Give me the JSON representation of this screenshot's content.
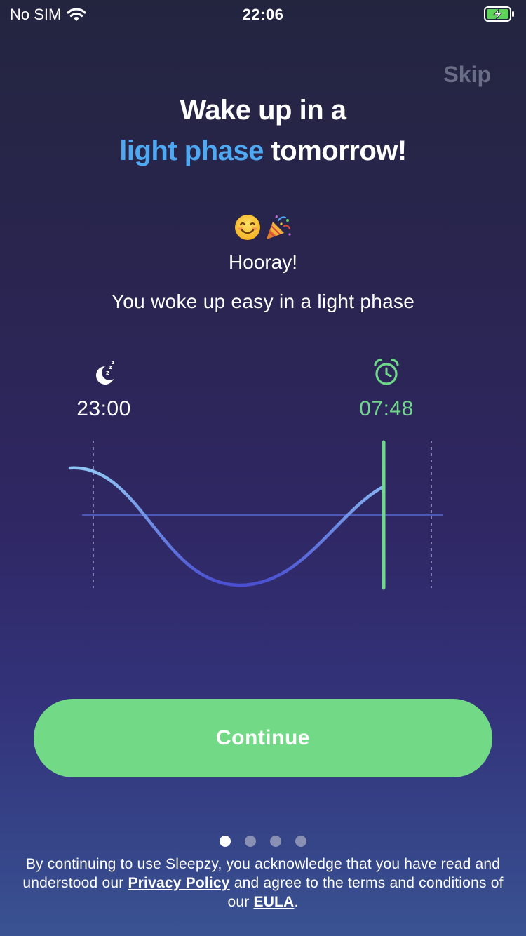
{
  "status_bar": {
    "carrier": "No SIM",
    "time": "22:06",
    "icons": [
      "wifi-icon",
      "battery-charging-icon"
    ]
  },
  "header": {
    "skip_label": "Skip",
    "title_line1": "Wake up in a",
    "title_accent": "light phase",
    "title_rest": " tomorrow!"
  },
  "message": {
    "emoji_icons": [
      "smiling-face-icon",
      "party-popper-icon"
    ],
    "heading": "Hooray!",
    "body": "You woke up easy in a light phase"
  },
  "schedule": {
    "sleep": {
      "icon": "moon-sleep-icon",
      "time": "23:00"
    },
    "wake": {
      "icon": "alarm-clock-icon",
      "time": "07:48"
    }
  },
  "actions": {
    "continue_label": "Continue"
  },
  "pagination": {
    "total": 4,
    "active_index": 0
  },
  "legal": {
    "text_before": "By continuing to use Sleepzy, you acknowledge that you have read and understood our ",
    "privacy_link": "Privacy Policy",
    "text_middle": " and agree to the terms and conditions of our ",
    "eula_link": "EULA",
    "text_after": "."
  },
  "colors": {
    "accent_blue": "#4ea8f2",
    "accent_green": "#72d987",
    "wake_green": "#6fd78a"
  }
}
